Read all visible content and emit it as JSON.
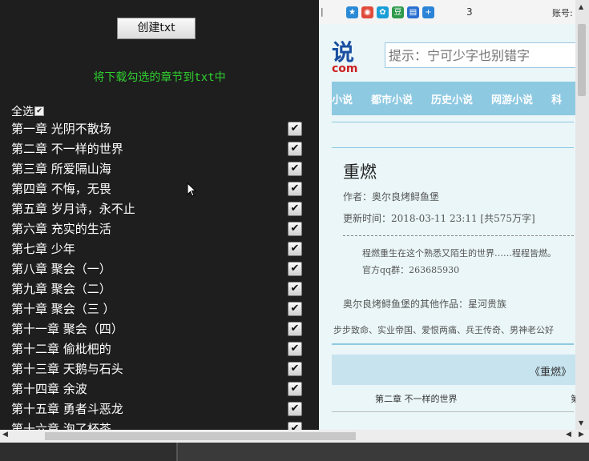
{
  "left_panel": {
    "create_button": "创建txt",
    "instruction": "将下载勾选的章节到txt中",
    "select_all": "全选",
    "chapters": [
      "第一章 光阴不散场",
      "第二章 不一样的世界",
      "第三章 所爱隔山海",
      "第四章 不悔，无畏",
      "第五章 岁月诗，永不止",
      "第六章 充实的生活",
      "第七章 少年",
      "第八章 聚会（一）",
      "第九章 聚会（二）",
      "第十章 聚会（三 ）",
      "第十一章 聚会（四）",
      "第十二章 偷枇杷的",
      "第十三章 天鹅与石头",
      "第十四章 余波",
      "第十五章 勇者斗恶龙",
      "第十六章 泡了杯茶"
    ]
  },
  "browser": {
    "toolbar": {
      "icons": [
        "star-icon",
        "weibo-icon",
        "qzone-icon",
        "douban-icon",
        "renren-icon",
        "plus-icon"
      ],
      "icon_colors": [
        "#2b8ad6",
        "#e04a3a",
        "#1b9ed8",
        "#2e9b4c",
        "#2a6fd1",
        "#2a83d6"
      ],
      "count": "3",
      "account_label": "账号:"
    },
    "logo_text": "说",
    "logo_com": "com",
    "search_placeholder": "提示：宁可少字也别错字",
    "nav_items": [
      "小说",
      "都市小说",
      "历史小说",
      "网游小说",
      "科"
    ],
    "book": {
      "title": "重燃",
      "author": "作者：奥尔良烤鲟鱼堡",
      "update": "更新时间：2018-03-11 23:11  [共575万字]",
      "intro_line1": "程燃重生在这个熟悉又陌生的世界……程程皆燃。",
      "intro_line2": "官方qq群：263685930",
      "other_works": "奥尔良烤鲟鱼堡的其他作品：星河贵族",
      "tags": "步步致命、实业帝国、爱恨两痛、兵王传奇、男神老公好",
      "section_title": "《重燃》",
      "chapter_link": "第二章 不一样的世界",
      "chapter_link_cut": "第"
    }
  },
  "colors": {
    "instruction": "#2fd02f",
    "nav_bg": "#8ec9e2",
    "page_bg": "#eaf6f8"
  }
}
